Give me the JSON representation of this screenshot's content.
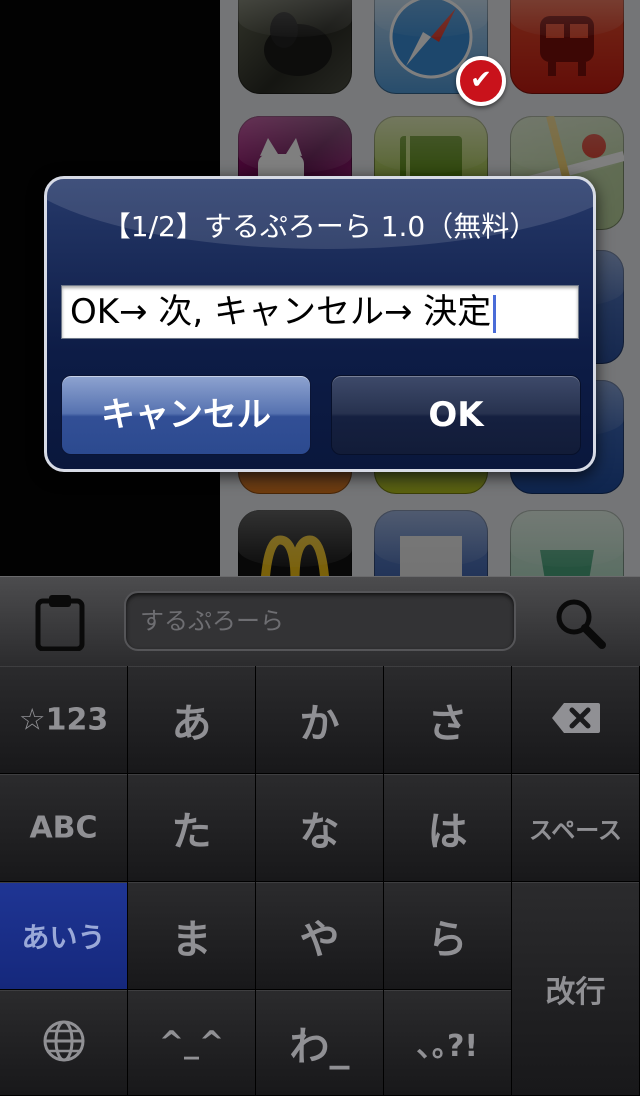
{
  "background": {
    "badge_text": "✔",
    "icons": [
      "dog-photo-app-icon",
      "safari-icon",
      "train-app-icon",
      "cat-app-icon",
      "notebook-app-icon",
      "maps-icon",
      "mcdonalds-icon",
      "document-app-icon",
      "app-store-icon"
    ]
  },
  "alert": {
    "title": "【1/2】するぷろーら 1.0（無料）",
    "field_text": "OK→ 次, キャンセル→ 決定",
    "cancel_label": "キャンセル",
    "ok_label": "OK"
  },
  "bar": {
    "search_placeholder": "するぷろーら",
    "clipboard_icon": "clipboard-icon",
    "search_icon": "search-icon"
  },
  "keyboard": {
    "mode_symbols": "☆123",
    "mode_abc": "ABC",
    "mode_kana": "あいう",
    "globe_icon": "globe-icon",
    "row1": [
      "あ",
      "か",
      "さ"
    ],
    "row2": [
      "た",
      "な",
      "は"
    ],
    "row3": [
      "ま",
      "や",
      "ら"
    ],
    "row4": [
      "^_^",
      "わ_",
      "､｡?!"
    ],
    "delete_icon": "delete-icon",
    "space_label": "スペース",
    "return_label": "改行"
  },
  "colors": {
    "alert_background": "#0d1c46",
    "keyboard_active": "#15287c",
    "key_text": "#909094"
  }
}
